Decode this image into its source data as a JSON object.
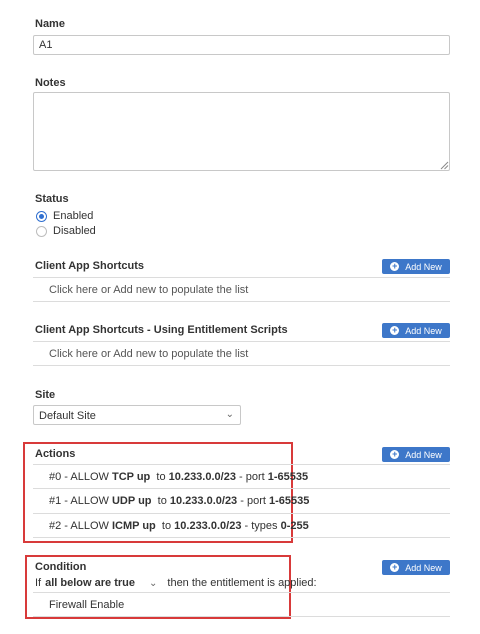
{
  "name": {
    "label": "Name",
    "value": "A1"
  },
  "notes": {
    "label": "Notes",
    "value": ""
  },
  "status": {
    "label": "Status",
    "options": [
      {
        "label": "Enabled",
        "checked": true
      },
      {
        "label": "Disabled",
        "checked": false
      }
    ]
  },
  "shortcuts": {
    "label": "Client App Shortcuts",
    "add_label": "Add New",
    "empty_text": "Click here or Add new to populate the list"
  },
  "shortcuts_scripts": {
    "label": "Client App Shortcuts - Using Entitlement Scripts",
    "add_label": "Add New",
    "empty_text": "Click here or Add new to populate the list"
  },
  "site": {
    "label": "Site",
    "selected": "Default Site"
  },
  "actions": {
    "label": "Actions",
    "add_label": "Add New",
    "items": [
      {
        "prefix": "#0 - ALLOW",
        "proto": "TCP up",
        "to": "to",
        "net": "10.233.0.0/23",
        "sep": "- port",
        "range": "1-65535"
      },
      {
        "prefix": "#1 - ALLOW",
        "proto": "UDP up",
        "to": "to",
        "net": "10.233.0.0/23",
        "sep": "- port",
        "range": "1-65535"
      },
      {
        "prefix": "#2 - ALLOW",
        "proto": "ICMP up",
        "to": "to",
        "net": "10.233.0.0/23",
        "sep": "- types",
        "range": "0-255"
      }
    ]
  },
  "condition": {
    "label": "Condition",
    "add_label": "Add New",
    "if_text": "If",
    "mode": "all below are true",
    "then_text": "then the entitlement is applied:",
    "items": [
      "Firewall Enable"
    ]
  },
  "colors": {
    "accent": "#3d77c9",
    "highlight": "#d83a3a"
  }
}
